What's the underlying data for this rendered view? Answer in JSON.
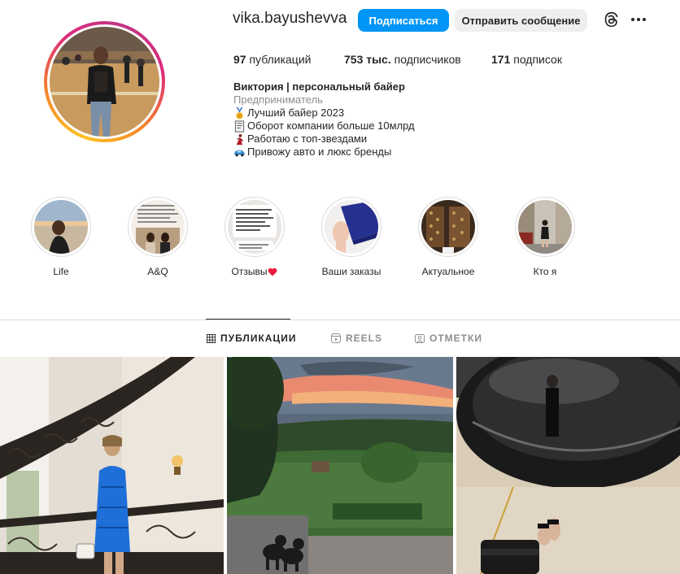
{
  "profile": {
    "username": "vika.bayushevva",
    "follow_label": "Подписаться",
    "message_label": "Отправить сообщение",
    "stats": {
      "posts_count": "97",
      "posts_label": " публикаций",
      "followers_count": "753 тыс.",
      "followers_label": " подписчиков",
      "following_count": "171",
      "following_label": " подписок"
    },
    "bio": {
      "name": "Виктория | персональный байер",
      "category": "Предприниматель",
      "lines": [
        {
          "icon": "medal-icon",
          "text": "Лучший байер 2023"
        },
        {
          "icon": "receipt-icon",
          "text": "Оборот компании больше 10млрд"
        },
        {
          "icon": "dancer-icon",
          "text": "Работаю с топ-звездами"
        },
        {
          "icon": "car-icon",
          "text": "Привожу авто и люкс бренды"
        }
      ]
    }
  },
  "highlights": [
    {
      "label": "Life"
    },
    {
      "label": "A&Q"
    },
    {
      "label": "Отзывы",
      "icon": "red-heart-icon"
    },
    {
      "label": "Ваши заказы"
    },
    {
      "label": "Актуальное"
    },
    {
      "label": "Кто я"
    }
  ],
  "tabs": [
    {
      "label": "ПУБЛИКАЦИИ",
      "icon": "grid-icon",
      "active": true
    },
    {
      "label": "REELS",
      "icon": "reels-icon",
      "active": false
    },
    {
      "label": "ОТМЕТКИ",
      "icon": "tagged-icon",
      "active": false
    }
  ],
  "colors": {
    "follow_button": "#0095f6",
    "message_button": "#efefef",
    "text": "#262626",
    "muted": "#8e8e8e",
    "heart": "#ed1c3b"
  }
}
